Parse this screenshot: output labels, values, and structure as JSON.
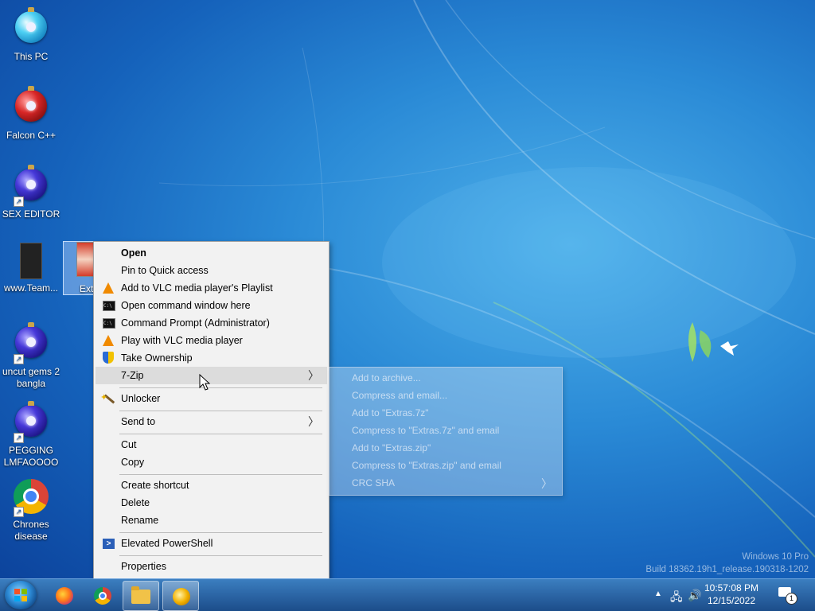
{
  "desktop": {
    "icons": [
      {
        "label": "This PC"
      },
      {
        "label": "Falcon C++"
      },
      {
        "label": "SEX EDITOR"
      },
      {
        "label": "www.Team..."
      },
      {
        "label": "Ext"
      },
      {
        "label": "uncut gems 2 bangla"
      },
      {
        "label": "PEGGING LMFAOOOO"
      },
      {
        "label": "Chrones disease"
      }
    ]
  },
  "context_menu": {
    "items": [
      {
        "label": "Open",
        "icon": "none"
      },
      {
        "label": "Pin to Quick access",
        "icon": "none"
      },
      {
        "label": "Add to VLC media player's Playlist",
        "icon": "vlc-icon"
      },
      {
        "label": "Open command window here",
        "icon": "cmd-icon"
      },
      {
        "label": "Command Prompt (Administrator)",
        "icon": "cmd-icon"
      },
      {
        "label": "Play with VLC media player",
        "icon": "vlc-icon"
      },
      {
        "label": "Take Ownership",
        "icon": "shield-icon"
      },
      {
        "label": "7-Zip",
        "icon": "none"
      },
      {
        "label": "Unlocker",
        "icon": "wand-icon"
      },
      {
        "label": "Send to",
        "icon": "none"
      },
      {
        "label": "Cut",
        "icon": "none"
      },
      {
        "label": "Copy",
        "icon": "none"
      },
      {
        "label": "Create shortcut",
        "icon": "none"
      },
      {
        "label": "Delete",
        "icon": "none"
      },
      {
        "label": "Rename",
        "icon": "none"
      },
      {
        "label": "Elevated PowerShell",
        "icon": "powershell-icon"
      },
      {
        "label": "Properties",
        "icon": "none"
      }
    ]
  },
  "submenu_7zip": {
    "items": [
      {
        "label": "Add to archive..."
      },
      {
        "label": "Compress and email..."
      },
      {
        "label": "Add to \"Extras.7z\""
      },
      {
        "label": "Compress to \"Extras.7z\" and email"
      },
      {
        "label": "Add to \"Extras.zip\""
      },
      {
        "label": "Compress to \"Extras.zip\" and email"
      },
      {
        "label": "CRC SHA"
      }
    ]
  },
  "taskbar": {
    "clock_time": "10:57:08 PM",
    "clock_date": "12/15/2022",
    "notification_count": "1"
  },
  "watermark": {
    "line1": "Windows 10 Pro",
    "line2": "Build 18362.19h1_release.190318-1202"
  }
}
